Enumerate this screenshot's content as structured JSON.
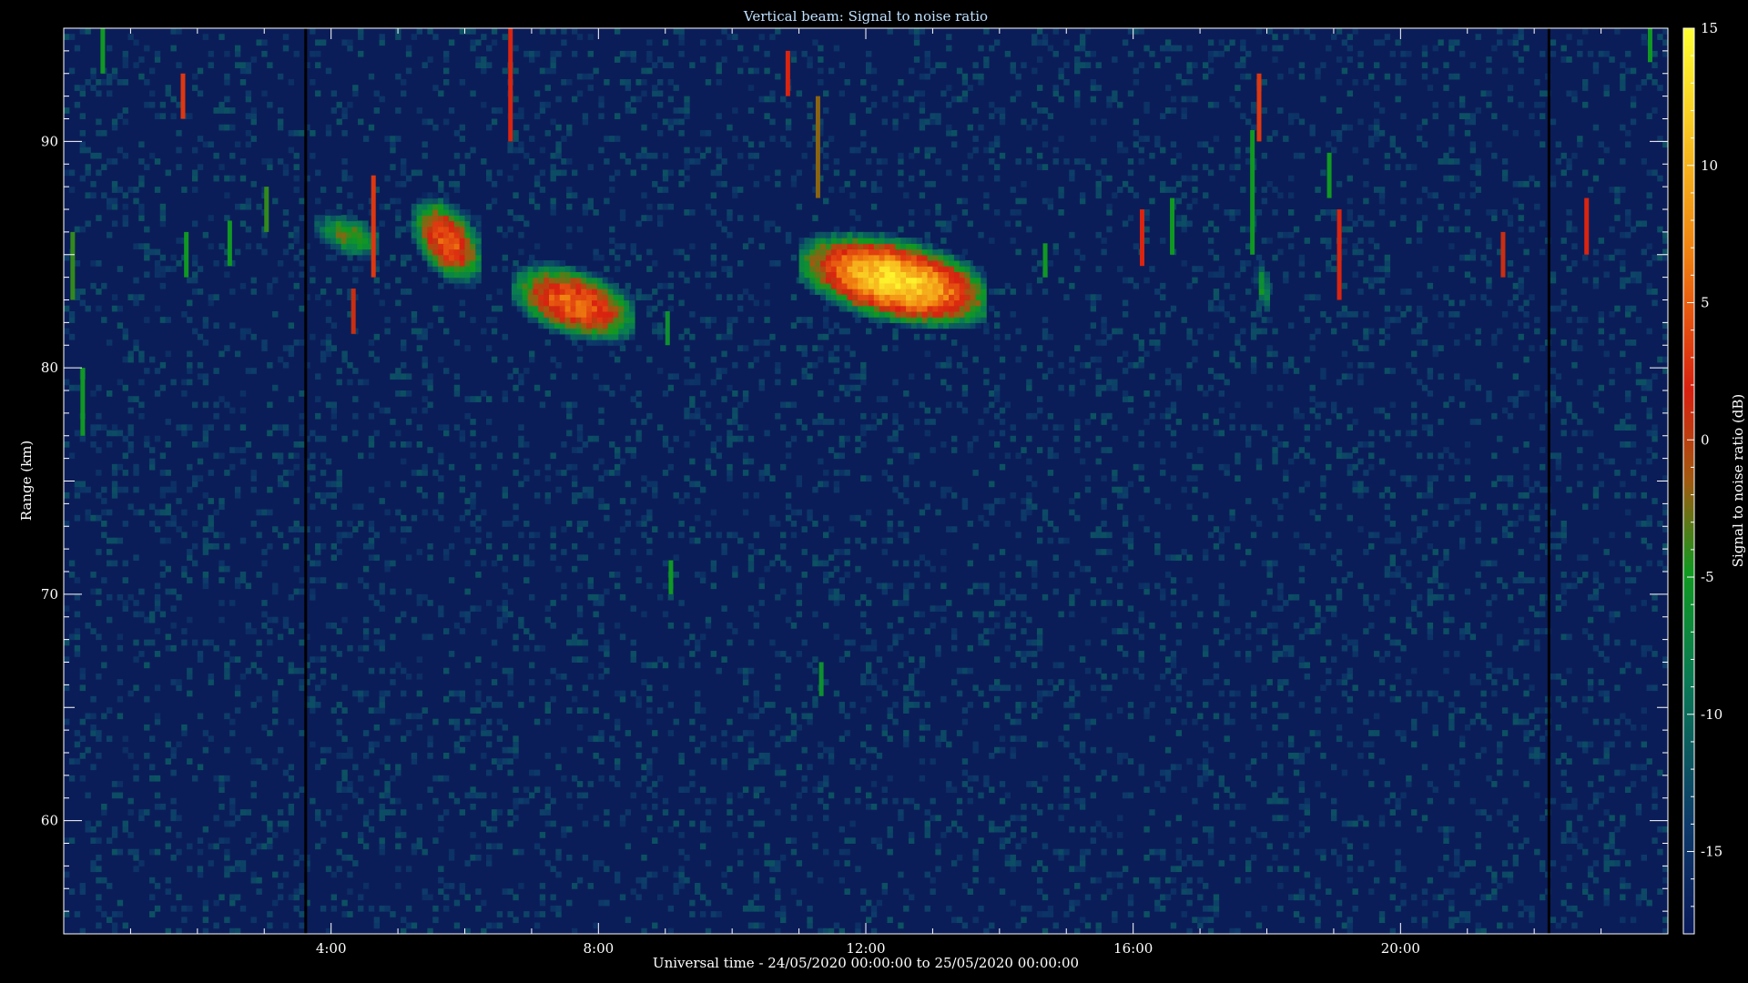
{
  "chart_data": {
    "type": "heatmap",
    "title": "Vertical beam: Signal to noise ratio",
    "xlabel": "Universal time - 24/05/2020 00:00:00 to 25/05/2020 00:00:00",
    "ylabel": "Range (km)",
    "x_unit": "hours UT",
    "xlim": [
      0,
      24
    ],
    "ylim": [
      55,
      95
    ],
    "x_ticks": [
      {
        "value": 4,
        "label": "4:00"
      },
      {
        "value": 8,
        "label": "8:00"
      },
      {
        "value": 12,
        "label": "12:00"
      },
      {
        "value": 16,
        "label": "16:00"
      },
      {
        "value": 20,
        "label": "20:00"
      }
    ],
    "y_ticks": [
      {
        "value": 60,
        "label": "60"
      },
      {
        "value": 70,
        "label": "70"
      },
      {
        "value": 80,
        "label": "80"
      },
      {
        "value": 90,
        "label": "90"
      }
    ],
    "colorbar": {
      "label": "Signal to noise ratio (dB)",
      "range": [
        -18,
        15
      ],
      "ticks": [
        {
          "value": 15,
          "label": "15"
        },
        {
          "value": 10,
          "label": "10"
        },
        {
          "value": 5,
          "label": "5"
        },
        {
          "value": 0,
          "label": "0"
        },
        {
          "value": -5,
          "label": "-5"
        },
        {
          "value": -10,
          "label": "-10"
        },
        {
          "value": -15,
          "label": "-15"
        }
      ],
      "colors": [
        "#0a1a5a",
        "#0d3a6a",
        "#0a7a55",
        "#109a20",
        "#a05a10",
        "#d82010",
        "#f08010",
        "#ffff30"
      ]
    },
    "background_snr_db": -17,
    "echo_regions": [
      {
        "t_start": 3.75,
        "t_end": 4.7,
        "range_min": 84.5,
        "range_max": 87.0,
        "peak_snr_db": -3
      },
      {
        "t_start": 5.2,
        "t_end": 6.2,
        "range_min": 83.0,
        "range_max": 88.0,
        "peak_snr_db": 5
      },
      {
        "t_start": 6.7,
        "t_end": 8.5,
        "range_min": 80.5,
        "range_max": 85.0,
        "peak_snr_db": 6
      },
      {
        "t_start": 11.0,
        "t_end": 13.8,
        "range_min": 81.0,
        "range_max": 86.5,
        "peak_snr_db": 13
      },
      {
        "t_start": 17.8,
        "t_end": 18.0,
        "range_min": 82.0,
        "range_max": 85.0,
        "peak_snr_db": -5
      }
    ],
    "streaks": [
      {
        "t": 0.1,
        "range_min": 83,
        "range_max": 86,
        "snr_db": -4
      },
      {
        "t": 0.25,
        "range_min": 77,
        "range_max": 80,
        "snr_db": -5
      },
      {
        "t": 0.55,
        "range_min": 93,
        "range_max": 95,
        "snr_db": -5
      },
      {
        "t": 1.75,
        "range_min": 91,
        "range_max": 93,
        "snr_db": 3
      },
      {
        "t": 1.8,
        "range_min": 84,
        "range_max": 86,
        "snr_db": -5
      },
      {
        "t": 2.45,
        "range_min": 84.5,
        "range_max": 86.5,
        "snr_db": -5
      },
      {
        "t": 3.0,
        "range_min": 86,
        "range_max": 88,
        "snr_db": -4
      },
      {
        "t": 4.3,
        "range_min": 81.5,
        "range_max": 83.5,
        "snr_db": 1
      },
      {
        "t": 4.6,
        "range_min": 84,
        "range_max": 88.5,
        "snr_db": 3
      },
      {
        "t": 6.65,
        "range_min": 90,
        "range_max": 95,
        "snr_db": 2
      },
      {
        "t": 9.05,
        "range_min": 70,
        "range_max": 71.5,
        "snr_db": -5
      },
      {
        "t": 9.0,
        "range_min": 81,
        "range_max": 82.5,
        "snr_db": -6
      },
      {
        "t": 10.8,
        "range_min": 92,
        "range_max": 94,
        "snr_db": 2
      },
      {
        "t": 11.25,
        "range_min": 87.5,
        "range_max": 92,
        "snr_db": -2
      },
      {
        "t": 11.3,
        "range_min": 65.5,
        "range_max": 67,
        "snr_db": -6
      },
      {
        "t": 14.65,
        "range_min": 84,
        "range_max": 85.5,
        "snr_db": -5
      },
      {
        "t": 16.1,
        "range_min": 84.5,
        "range_max": 87,
        "snr_db": 2
      },
      {
        "t": 16.55,
        "range_min": 85,
        "range_max": 87.5,
        "snr_db": -5
      },
      {
        "t": 17.85,
        "range_min": 90,
        "range_max": 93,
        "snr_db": 3
      },
      {
        "t": 17.75,
        "range_min": 85,
        "range_max": 90.5,
        "snr_db": -5
      },
      {
        "t": 18.9,
        "range_min": 87.5,
        "range_max": 89.5,
        "snr_db": -5
      },
      {
        "t": 19.05,
        "range_min": 83,
        "range_max": 87,
        "snr_db": 2
      },
      {
        "t": 21.5,
        "range_min": 84,
        "range_max": 86,
        "snr_db": 1
      },
      {
        "t": 22.75,
        "range_min": 85,
        "range_max": 87.5,
        "snr_db": 2
      },
      {
        "t": 23.7,
        "range_min": 93.5,
        "range_max": 95,
        "snr_db": -5
      }
    ],
    "data_gaps_t": [
      3.6,
      22.2
    ],
    "grid": false,
    "legend": "colorbar-right"
  }
}
